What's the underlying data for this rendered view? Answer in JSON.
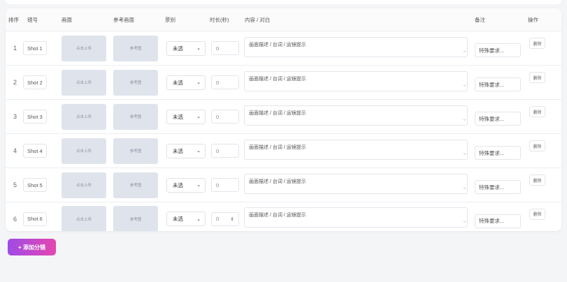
{
  "table": {
    "headers": {
      "order": "排序",
      "shot_no": "镜号",
      "frame": "画面",
      "reference": "参考画面",
      "shot_type": "景别",
      "duration": "时长(秒)",
      "content": "内容 / 对白",
      "notes": "备注",
      "actions": "操作"
    },
    "rows": [
      {
        "index": "1",
        "shot": "Shot 1",
        "upload": "点击上传",
        "ref": "参考图",
        "shot_type": "未选",
        "duration": "0",
        "content_placeholder": "画面描述 / 台词 / 运镜提示",
        "notes_placeholder": "特殊要求...",
        "delete": "删除"
      },
      {
        "index": "2",
        "shot": "Shot 2",
        "upload": "点击上传",
        "ref": "参考图",
        "shot_type": "未选",
        "duration": "0",
        "content_placeholder": "画面描述 / 台词 / 运镜提示",
        "notes_placeholder": "特殊要求...",
        "delete": "删除"
      },
      {
        "index": "3",
        "shot": "Shot 3",
        "upload": "点击上传",
        "ref": "参考图",
        "shot_type": "未选",
        "duration": "0",
        "content_placeholder": "画面描述 / 台词 / 运镜提示",
        "notes_placeholder": "特殊要求...",
        "delete": "删除"
      },
      {
        "index": "4",
        "shot": "Shot 4",
        "upload": "点击上传",
        "ref": "参考图",
        "shot_type": "未选",
        "duration": "0",
        "content_placeholder": "画面描述 / 台词 / 运镜提示",
        "notes_placeholder": "特殊要求...",
        "delete": "删除"
      },
      {
        "index": "5",
        "shot": "Shot 5",
        "upload": "点击上传",
        "ref": "参考图",
        "shot_type": "未选",
        "duration": "0",
        "content_placeholder": "画面描述 / 台词 / 运镜提示",
        "notes_placeholder": "特殊要求...",
        "delete": "删除"
      },
      {
        "index": "6",
        "shot": "Shot 6",
        "upload": "点击上传",
        "ref": "参考图",
        "shot_type": "未选",
        "duration": "0",
        "content_placeholder": "画面描述 / 台词 / 运镜提示",
        "notes_placeholder": "特殊要求...",
        "delete": "删除"
      }
    ]
  },
  "icons": {
    "select_arrow": "chevron-down-icon",
    "stepper": "spinner-arrows-icon",
    "resize": "resize-handle-icon"
  },
  "add_button": {
    "label": "+ 添加分镜"
  },
  "colors": {
    "accent_start": "#9f4be6",
    "accent_end": "#e546b0",
    "upload_bg": "#dfe4ec",
    "page_bg": "#f4f5f7"
  }
}
